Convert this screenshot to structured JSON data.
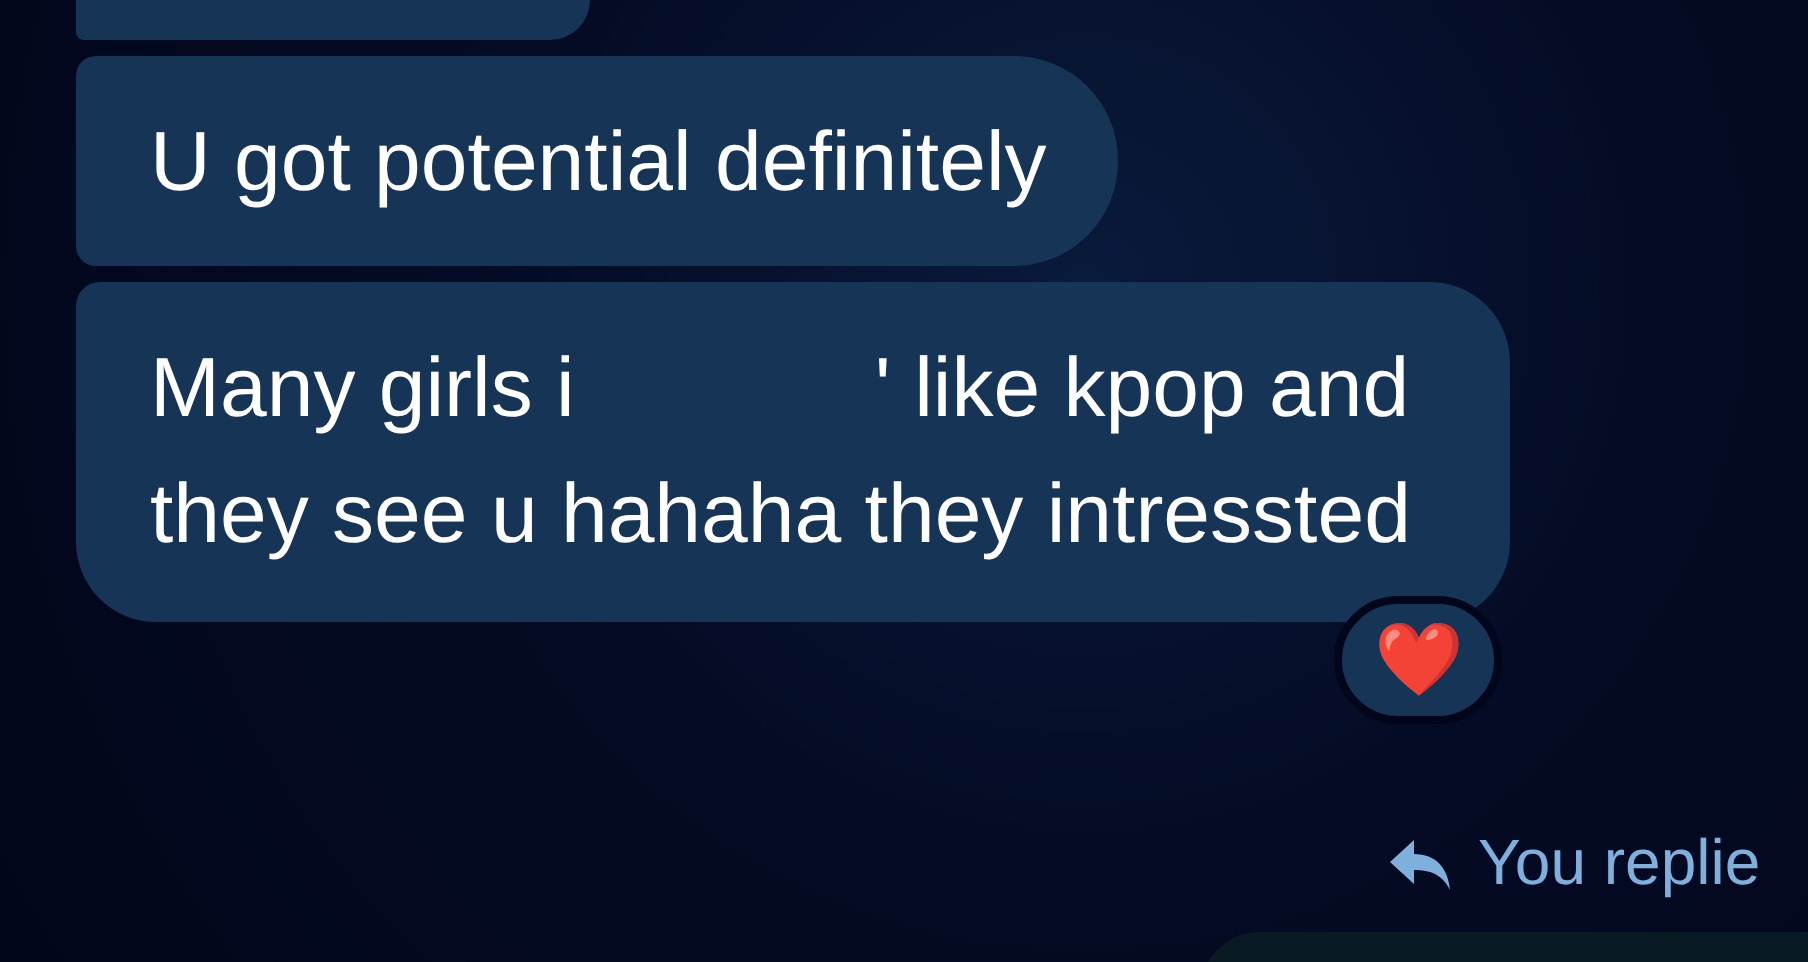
{
  "messages": [
    {
      "kind": "cut"
    },
    {
      "kind": "full",
      "lines": [
        [
          "U got potential definitely"
        ]
      ]
    },
    {
      "kind": "full",
      "lines": [
        [
          "Many girls i",
          "' like kpop and"
        ],
        [
          "they see u hahaha they intressted"
        ]
      ],
      "reaction": "❤️"
    }
  ],
  "reply_note": {
    "text": "You replie"
  }
}
